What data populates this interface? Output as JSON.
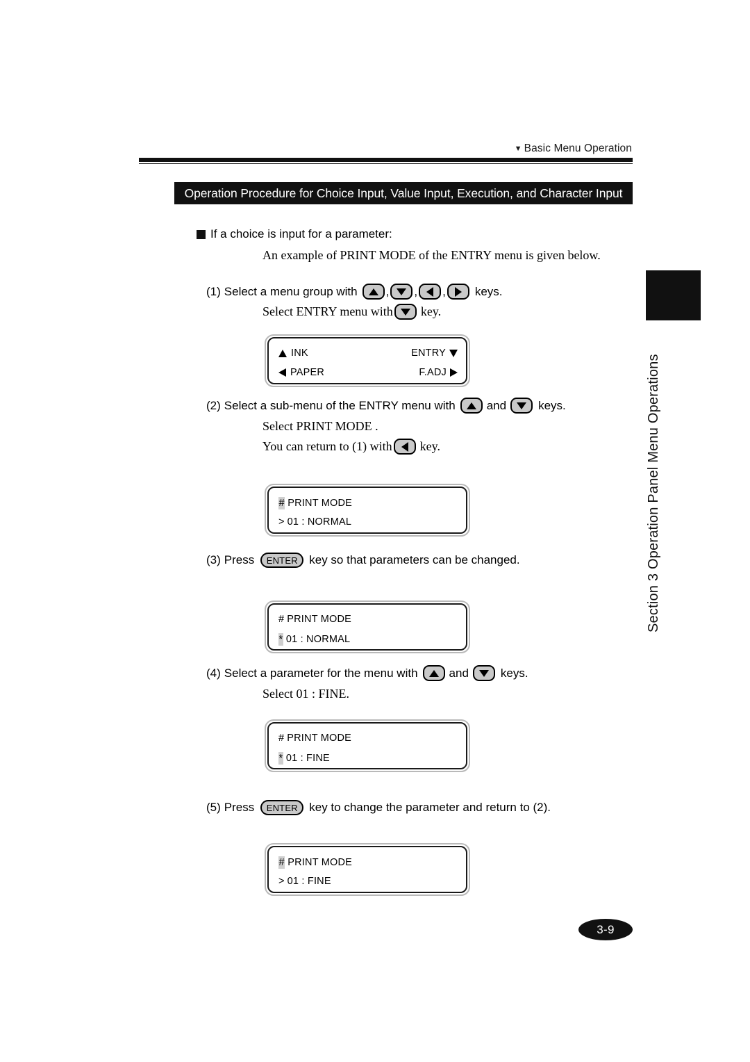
{
  "header": {
    "marker": "▼",
    "running_head": "Basic Menu Operation",
    "title_bar": "Operation Procedure for Choice Input, Value Input, Execution, and Character Input"
  },
  "intro": {
    "bullet": "If a choice is input for a parameter:",
    "example_note": "An example of PRINT MODE of the ENTRY menu is given below."
  },
  "steps": [
    {
      "number": "(1)",
      "lead": "Select a menu group with",
      "keys": [
        "up",
        "down",
        "left",
        "right"
      ],
      "trail": "keys.",
      "sub1_pre": "Select ENTRY menu with",
      "sub1_key": "down",
      "sub1_post": "key."
    },
    {
      "number": "(2)",
      "lead": "Select a sub-menu of the ENTRY menu with",
      "keys": [
        "up",
        "down"
      ],
      "conjunction": "and",
      "trail": "keys.",
      "sub1": "Select PRINT MODE .",
      "sub2_pre": "You can return to (1) with",
      "sub2_key": "left",
      "sub2_post": "key."
    },
    {
      "number": "(3)",
      "pre": "Press",
      "key_label": "ENTER",
      "post": "key so that parameters can be changed."
    },
    {
      "number": "(4)",
      "lead": "Select a parameter for the menu with",
      "keys": [
        "up",
        "down"
      ],
      "conjunction": "and",
      "trail": "keys.",
      "sub1": "Select 01 : FINE."
    },
    {
      "number": "(5)",
      "pre": "Press",
      "key_label": "ENTER",
      "post": "key to change the parameter and return to (2)."
    }
  ],
  "displays": [
    {
      "id": "menu-group-display",
      "row1_left_arrow": "up",
      "row1_left": "INK",
      "row1_right": "ENTRY",
      "row1_right_arrow": "down",
      "row2_left_arrow": "left",
      "row2_left": "PAPER",
      "row2_right": "F.ADJ",
      "row2_right_arrow": "right"
    },
    {
      "id": "print-mode-browse-display",
      "row1_cursor": "#",
      "row1_cursor_highlight": true,
      "row1_text": "PRINT MODE",
      "row2_cursor": ">",
      "row2_cursor_highlight": false,
      "row2_text": "01 : NORMAL"
    },
    {
      "id": "print-mode-editable-display",
      "row1_cursor": "#",
      "row1_cursor_highlight": false,
      "row1_text": "PRINT MODE",
      "row2_cursor": "*",
      "row2_cursor_highlight": true,
      "row2_text": "01 : NORMAL"
    },
    {
      "id": "print-mode-fine-editable-display",
      "row1_cursor": "#",
      "row1_cursor_highlight": false,
      "row1_text": "PRINT MODE",
      "row2_cursor": "*",
      "row2_cursor_highlight": true,
      "row2_text": "01 : FINE"
    },
    {
      "id": "print-mode-fine-confirmed-display",
      "row1_cursor": "#",
      "row1_cursor_highlight": true,
      "row1_text": "PRINT MODE",
      "row2_cursor": ">",
      "row2_cursor_highlight": false,
      "row2_text": "01 : FINE"
    }
  ],
  "side_tab": {
    "label": "Section 3  Operation Panel Menu Operations"
  },
  "footer": {
    "page_number": "3-9"
  }
}
